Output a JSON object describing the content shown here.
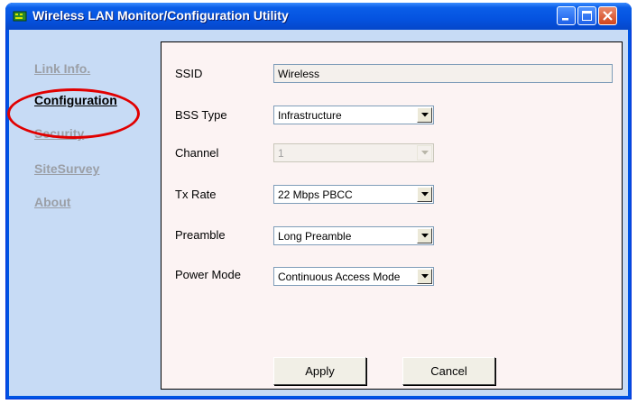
{
  "window": {
    "title": "Wireless LAN Monitor/Configuration Utility"
  },
  "nav": {
    "items": [
      {
        "label": "Link Info.",
        "active": false
      },
      {
        "label": "Configuration",
        "active": true
      },
      {
        "label": "Security",
        "active": false
      },
      {
        "label": "SiteSurvey",
        "active": false
      },
      {
        "label": "About",
        "active": false
      }
    ]
  },
  "form": {
    "ssid": {
      "label": "SSID",
      "value": "Wireless"
    },
    "bss_type": {
      "label": "BSS Type",
      "value": "Infrastructure"
    },
    "channel": {
      "label": "Channel",
      "value": "1",
      "enabled": false
    },
    "tx_rate": {
      "label": "Tx Rate",
      "value": "22 Mbps PBCC"
    },
    "preamble": {
      "label": "Preamble",
      "value": "Long Preamble"
    },
    "power_mode": {
      "label": "Power Mode",
      "value": "Continuous Access Mode"
    }
  },
  "buttons": {
    "apply": "Apply",
    "cancel": "Cancel"
  },
  "colors": {
    "client_bg": "#c7dbf5",
    "panel_bg": "#fcf3f3",
    "highlight_ring": "#e10000",
    "title_bar": "#0553e0"
  }
}
